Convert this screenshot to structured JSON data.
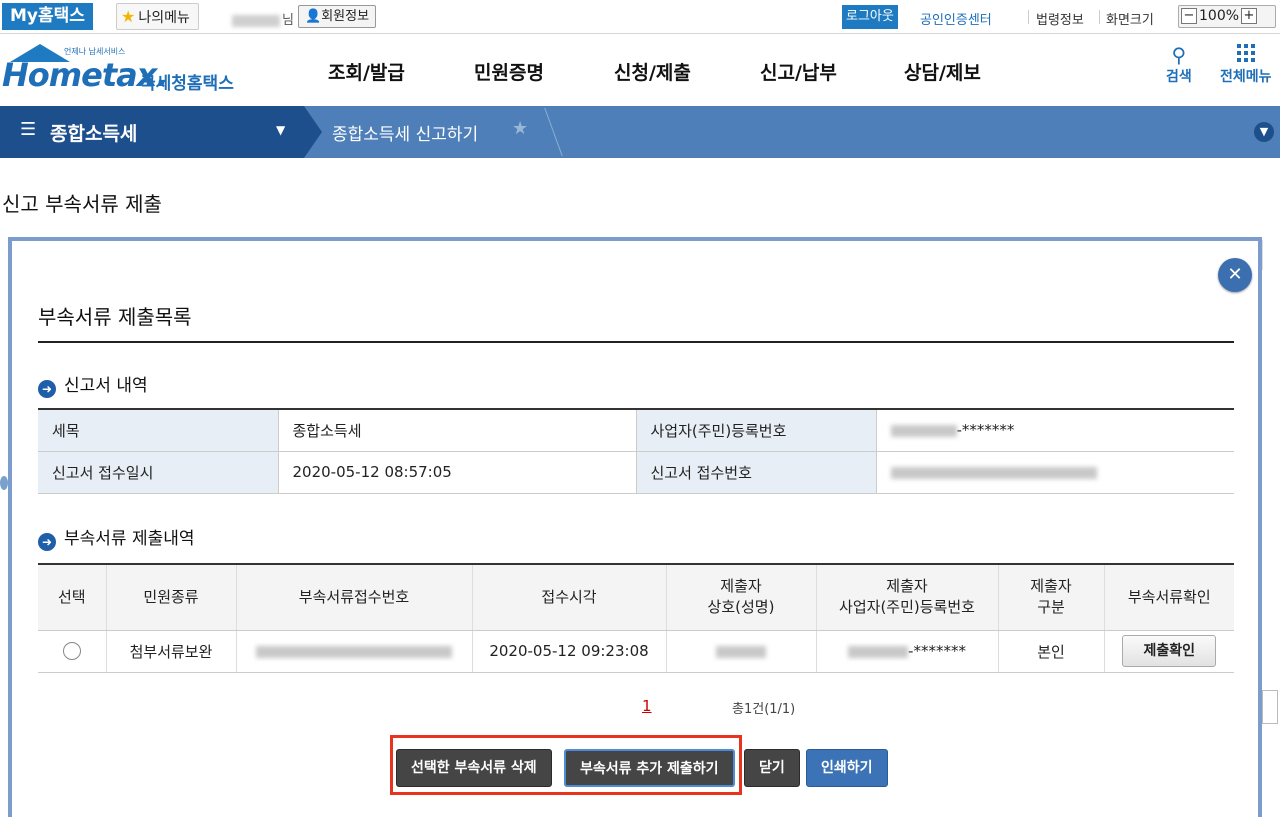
{
  "topbar": {
    "my_btn": "My홈택스",
    "mymenu": "나의메뉴",
    "username_suffix": "님",
    "member_info": "회원정보",
    "logout": "로그아웃",
    "cert_center": "공인인증센터",
    "law_info": "법령정보",
    "screen_size": "화면크기",
    "zoom_minus": "−",
    "zoom_value": "100%",
    "zoom_plus": "+"
  },
  "logo": {
    "brand": "Hometax.",
    "sub": "언제나 납세서비스",
    "korean": "국세청홈택스"
  },
  "nav": {
    "items": [
      "조회/발급",
      "민원증명",
      "신청/제출",
      "신고/납부",
      "상담/제보"
    ],
    "search": "검색",
    "all_menu": "전체메뉴"
  },
  "breadcrumb": {
    "section": "종합소득세",
    "current": "종합소득세 신고하기"
  },
  "page": {
    "title": "신고 부속서류 제출"
  },
  "modal": {
    "title": "부속서류 제출목록",
    "close": "✕",
    "report_section": "신고서 내역",
    "report": {
      "tax_item_label": "세목",
      "tax_item_value": "종합소득세",
      "reg_no_label": "사업자(주민)등록번호",
      "reg_no_value": "-*******",
      "receipt_dt_label": "신고서 접수일시",
      "receipt_dt_value": "2020-05-12 08:57:05",
      "receipt_no_label": "신고서 접수번호"
    },
    "attach_section": "부속서류 제출내역",
    "columns": {
      "select": "선택",
      "doc_type": "민원종류",
      "attach_no": "부속서류접수번호",
      "receipt_time": "접수시각",
      "submitter_l1": "제출자",
      "submitter_l2": "상호(성명)",
      "submitter_reg_l1": "제출자",
      "submitter_reg_l2": "사업자(주민)등록번호",
      "submitter_type_l1": "제출자",
      "submitter_type_l2": "구분",
      "confirm": "부속서류확인"
    },
    "rows": [
      {
        "doc_type": "첨부서류보완",
        "receipt_time": "2020-05-12 09:23:08",
        "reg_no": "-*******",
        "submitter_type": "본인",
        "confirm_btn": "제출확인"
      }
    ],
    "pager": {
      "page": "1",
      "total": "총1건(1/1)"
    },
    "buttons": {
      "delete": "선택한 부속서류 삭제",
      "add": "부속서류 추가 제출하기",
      "close": "닫기",
      "print": "인쇄하기"
    }
  }
}
